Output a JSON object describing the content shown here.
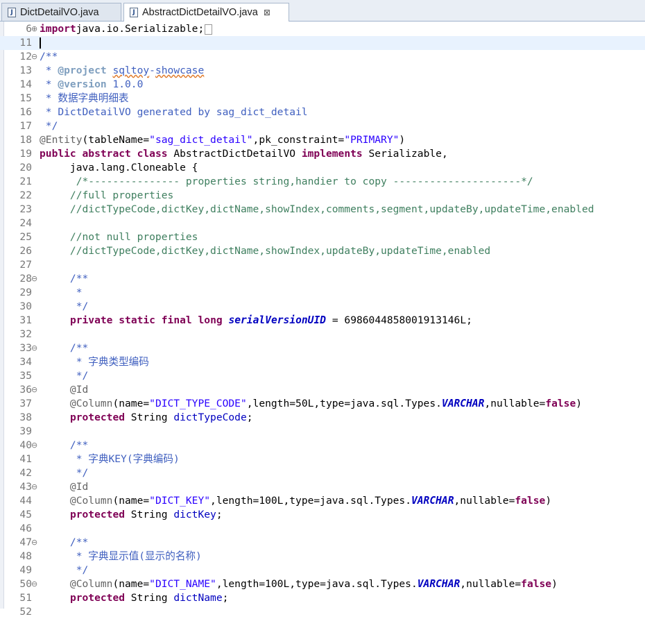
{
  "tabs": [
    {
      "label": "DictDetailVO.java",
      "active": false
    },
    {
      "label": "AbstractDictDetailVO.java",
      "active": true
    }
  ],
  "editor": {
    "current_line": 11,
    "lines": [
      {
        "n": "6",
        "fold": "⊕",
        "segs": [
          [
            "kw",
            "import"
          ],
          [
            "",
            "java.io.Serializable;"
          ]
        ],
        "folded": true
      },
      {
        "n": "11",
        "fold": "",
        "segs": []
      },
      {
        "n": "12",
        "fold": "⊖",
        "segs": [
          [
            "jd",
            "/**"
          ]
        ]
      },
      {
        "n": "13",
        "fold": "",
        "segs": [
          [
            "jd",
            " * "
          ],
          [
            "tag",
            "@project"
          ],
          [
            "jd",
            " "
          ],
          [
            "jdsq",
            "sqltoy"
          ],
          [
            "jd",
            "-"
          ],
          [
            "jdsq",
            "showcase"
          ]
        ]
      },
      {
        "n": "14",
        "fold": "",
        "segs": [
          [
            "jd",
            " * "
          ],
          [
            "tag",
            "@version"
          ],
          [
            "jd",
            " 1.0.0"
          ]
        ]
      },
      {
        "n": "15",
        "fold": "",
        "segs": [
          [
            "jd",
            " * 数据字典明细表"
          ]
        ]
      },
      {
        "n": "16",
        "fold": "",
        "segs": [
          [
            "jd",
            " * DictDetailVO generated by sag_dict_detail"
          ]
        ]
      },
      {
        "n": "17",
        "fold": "",
        "segs": [
          [
            "jd",
            " */"
          ]
        ]
      },
      {
        "n": "18",
        "fold": "",
        "segs": [
          [
            "ann",
            "@Entity"
          ],
          [
            "",
            "(tableName="
          ],
          [
            "str",
            "\"sag_dict_detail\""
          ],
          [
            "",
            ",pk_constraint="
          ],
          [
            "str",
            "\"PRIMARY\""
          ],
          [
            "",
            ")"
          ]
        ]
      },
      {
        "n": "19",
        "fold": "",
        "segs": [
          [
            "kw",
            "public"
          ],
          [
            "",
            " "
          ],
          [
            "kw",
            "abstract"
          ],
          [
            "",
            " "
          ],
          [
            "kw",
            "class"
          ],
          [
            "",
            " AbstractDictDetailVO "
          ],
          [
            "kw",
            "implements"
          ],
          [
            "",
            " Serializable,"
          ]
        ]
      },
      {
        "n": "20",
        "fold": "",
        "segs": [
          [
            "",
            "     java.lang.Cloneable {"
          ]
        ]
      },
      {
        "n": "21",
        "fold": "",
        "segs": [
          [
            "cm",
            "      /*--------------- properties string,handier to copy ---------------------*/"
          ]
        ]
      },
      {
        "n": "22",
        "fold": "",
        "segs": [
          [
            "cm",
            "     //full properties"
          ]
        ]
      },
      {
        "n": "23",
        "fold": "",
        "segs": [
          [
            "cm",
            "     //dictTypeCode,dictKey,dictName,showIndex,comments,segment,updateBy,updateTime,enabled"
          ]
        ]
      },
      {
        "n": "24",
        "fold": "",
        "segs": []
      },
      {
        "n": "25",
        "fold": "",
        "segs": [
          [
            "cm",
            "     //not null properties"
          ]
        ]
      },
      {
        "n": "26",
        "fold": "",
        "segs": [
          [
            "cm",
            "     //dictTypeCode,dictKey,dictName,showIndex,updateBy,updateTime,enabled"
          ]
        ]
      },
      {
        "n": "27",
        "fold": "",
        "segs": []
      },
      {
        "n": "28",
        "fold": "⊖",
        "segs": [
          [
            "jd",
            "     /**"
          ]
        ]
      },
      {
        "n": "29",
        "fold": "",
        "segs": [
          [
            "jd",
            "      *"
          ]
        ]
      },
      {
        "n": "30",
        "fold": "",
        "segs": [
          [
            "jd",
            "      */"
          ]
        ]
      },
      {
        "n": "31",
        "fold": "",
        "segs": [
          [
            "",
            "     "
          ],
          [
            "kw",
            "private"
          ],
          [
            "",
            " "
          ],
          [
            "kw",
            "static"
          ],
          [
            "",
            " "
          ],
          [
            "kw",
            "final"
          ],
          [
            "",
            " "
          ],
          [
            "kw",
            "long"
          ],
          [
            "",
            " "
          ],
          [
            "sfield",
            "serialVersionUID"
          ],
          [
            "",
            " = 6986044858001913146L;"
          ]
        ]
      },
      {
        "n": "32",
        "fold": "",
        "segs": []
      },
      {
        "n": "33",
        "fold": "⊖",
        "segs": [
          [
            "jd",
            "     /**"
          ]
        ]
      },
      {
        "n": "34",
        "fold": "",
        "segs": [
          [
            "jd",
            "      * 字典类型编码"
          ]
        ]
      },
      {
        "n": "35",
        "fold": "",
        "segs": [
          [
            "jd",
            "      */"
          ]
        ]
      },
      {
        "n": "36",
        "fold": "⊖",
        "segs": [
          [
            "ann",
            "     @Id"
          ]
        ]
      },
      {
        "n": "37",
        "fold": "",
        "segs": [
          [
            "ann",
            "     @Column"
          ],
          [
            "",
            "(name="
          ],
          [
            "str",
            "\"DICT_TYPE_CODE\""
          ],
          [
            "",
            ",length=50L,type=java.sql.Types."
          ],
          [
            "sfield",
            "VARCHAR"
          ],
          [
            "",
            ",nullable="
          ],
          [
            "kw",
            "false"
          ],
          [
            "",
            ")"
          ]
        ]
      },
      {
        "n": "38",
        "fold": "",
        "segs": [
          [
            "",
            "     "
          ],
          [
            "kw",
            "protected"
          ],
          [
            "",
            " String "
          ],
          [
            "field",
            "dictTypeCode"
          ],
          [
            "",
            ";"
          ]
        ]
      },
      {
        "n": "39",
        "fold": "",
        "segs": []
      },
      {
        "n": "40",
        "fold": "⊖",
        "segs": [
          [
            "jd",
            "     /**"
          ]
        ]
      },
      {
        "n": "41",
        "fold": "",
        "segs": [
          [
            "jd",
            "      * 字典KEY(字典编码)"
          ]
        ]
      },
      {
        "n": "42",
        "fold": "",
        "segs": [
          [
            "jd",
            "      */"
          ]
        ]
      },
      {
        "n": "43",
        "fold": "⊖",
        "segs": [
          [
            "ann",
            "     @Id"
          ]
        ]
      },
      {
        "n": "44",
        "fold": "",
        "segs": [
          [
            "ann",
            "     @Column"
          ],
          [
            "",
            "(name="
          ],
          [
            "str",
            "\"DICT_KEY\""
          ],
          [
            "",
            ",length=100L,type=java.sql.Types."
          ],
          [
            "sfield",
            "VARCHAR"
          ],
          [
            "",
            ",nullable="
          ],
          [
            "kw",
            "false"
          ],
          [
            "",
            ")"
          ]
        ]
      },
      {
        "n": "45",
        "fold": "",
        "segs": [
          [
            "",
            "     "
          ],
          [
            "kw",
            "protected"
          ],
          [
            "",
            " String "
          ],
          [
            "field",
            "dictKey"
          ],
          [
            "",
            ";"
          ]
        ]
      },
      {
        "n": "46",
        "fold": "",
        "segs": []
      },
      {
        "n": "47",
        "fold": "⊖",
        "segs": [
          [
            "jd",
            "     /**"
          ]
        ]
      },
      {
        "n": "48",
        "fold": "",
        "segs": [
          [
            "jd",
            "      * 字典显示值(显示的名称)"
          ]
        ]
      },
      {
        "n": "49",
        "fold": "",
        "segs": [
          [
            "jd",
            "      */"
          ]
        ]
      },
      {
        "n": "50",
        "fold": "⊖",
        "segs": [
          [
            "ann",
            "     @Column"
          ],
          [
            "",
            "(name="
          ],
          [
            "str",
            "\"DICT_NAME\""
          ],
          [
            "",
            ",length=100L,type=java.sql.Types."
          ],
          [
            "sfield",
            "VARCHAR"
          ],
          [
            "",
            ",nullable="
          ],
          [
            "kw",
            "false"
          ],
          [
            "",
            ")"
          ]
        ]
      },
      {
        "n": "51",
        "fold": "",
        "segs": [
          [
            "",
            "     "
          ],
          [
            "kw",
            "protected"
          ],
          [
            "",
            " String "
          ],
          [
            "field",
            "dictName"
          ],
          [
            "",
            ";"
          ]
        ]
      },
      {
        "n": "52",
        "fold": "",
        "segs": []
      }
    ]
  }
}
